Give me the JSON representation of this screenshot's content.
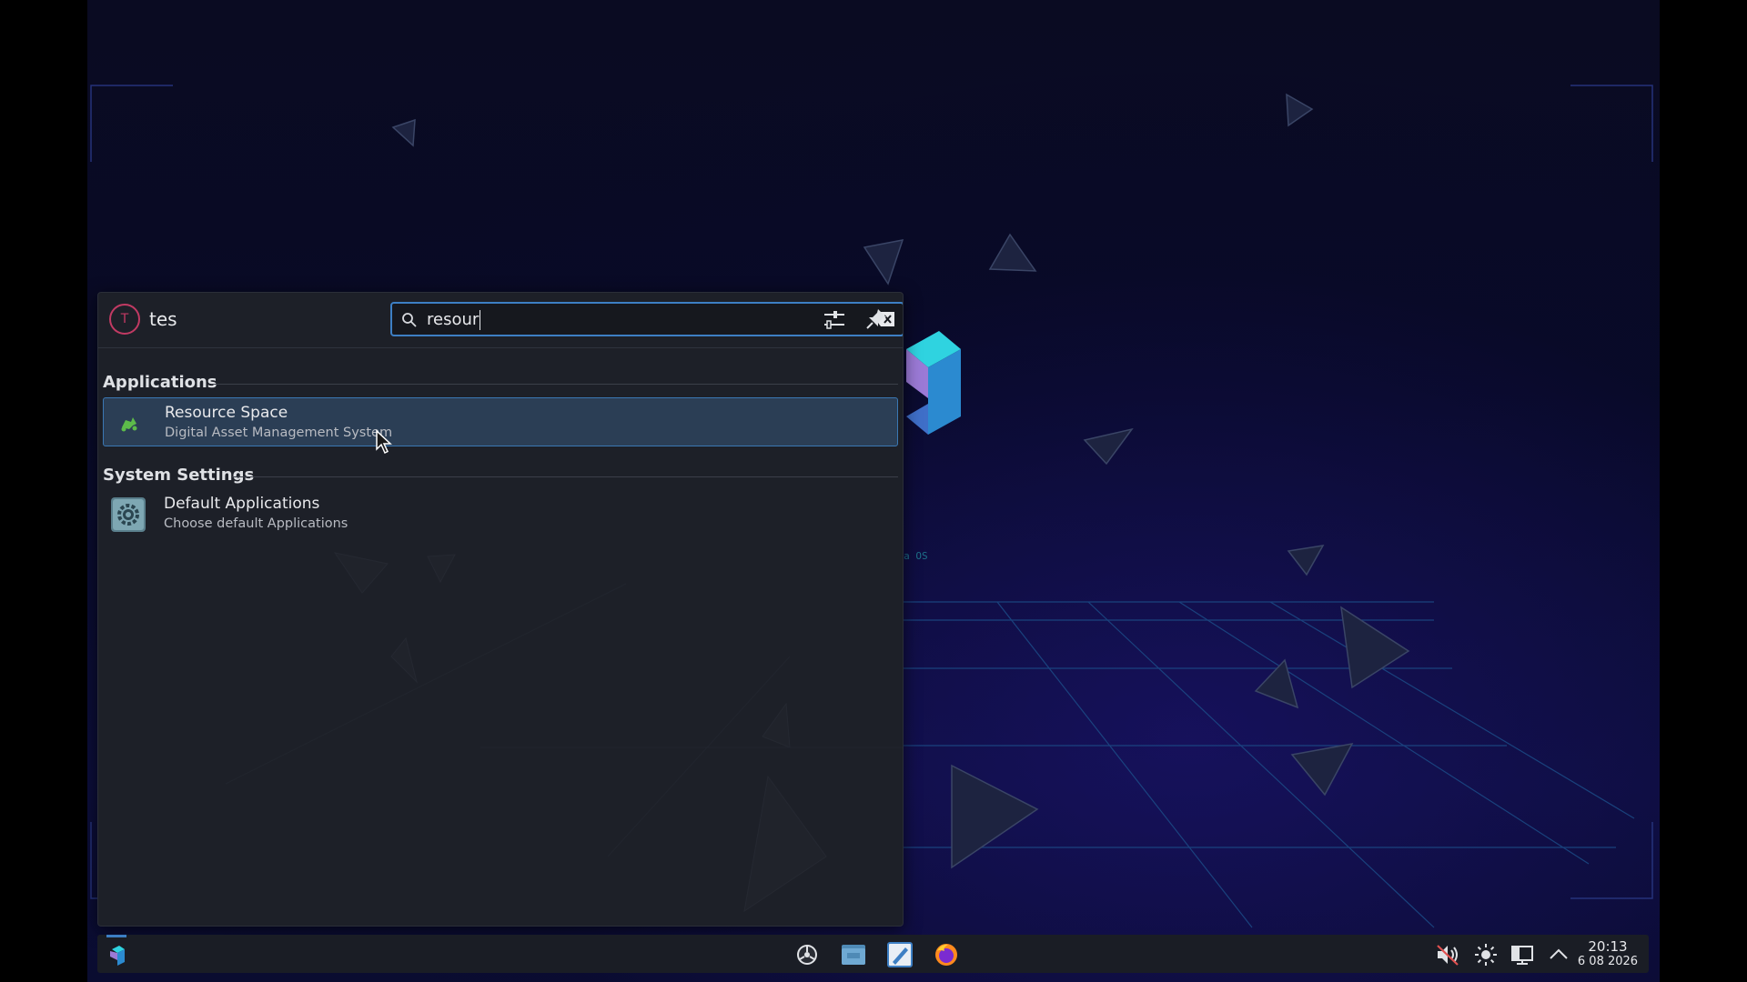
{
  "desktop": {
    "logo_caption": "Regata OS"
  },
  "launcher": {
    "user": {
      "avatar_letter": "T",
      "name": "tes"
    },
    "search": {
      "value": "resour",
      "icon": "search-icon"
    },
    "sections": [
      {
        "title": "Applications",
        "items": [
          {
            "title": "Resource Space",
            "subtitle": "Digital Asset Management System",
            "icon": "resourcespace-icon",
            "selected": true
          }
        ]
      },
      {
        "title": "System Settings",
        "items": [
          {
            "title": "Default Applications",
            "subtitle": "Choose default Applications",
            "icon": "settings-gear-icon",
            "selected": false
          }
        ]
      }
    ]
  },
  "taskbar": {
    "pinned": [
      "app-store-icon",
      "files-icon",
      "text-editor-icon",
      "firefox-icon"
    ],
    "tray": [
      "audio-muted-icon",
      "brightness-icon",
      "display-icon",
      "tray-expand-icon"
    ],
    "clock": {
      "time": "20:13",
      "date": "6 08 2026"
    }
  },
  "colors": {
    "accent": "#3d7fc4",
    "avatar": "#c13a63",
    "panel": "#1d2028",
    "selected_item": "#2b3e55"
  }
}
